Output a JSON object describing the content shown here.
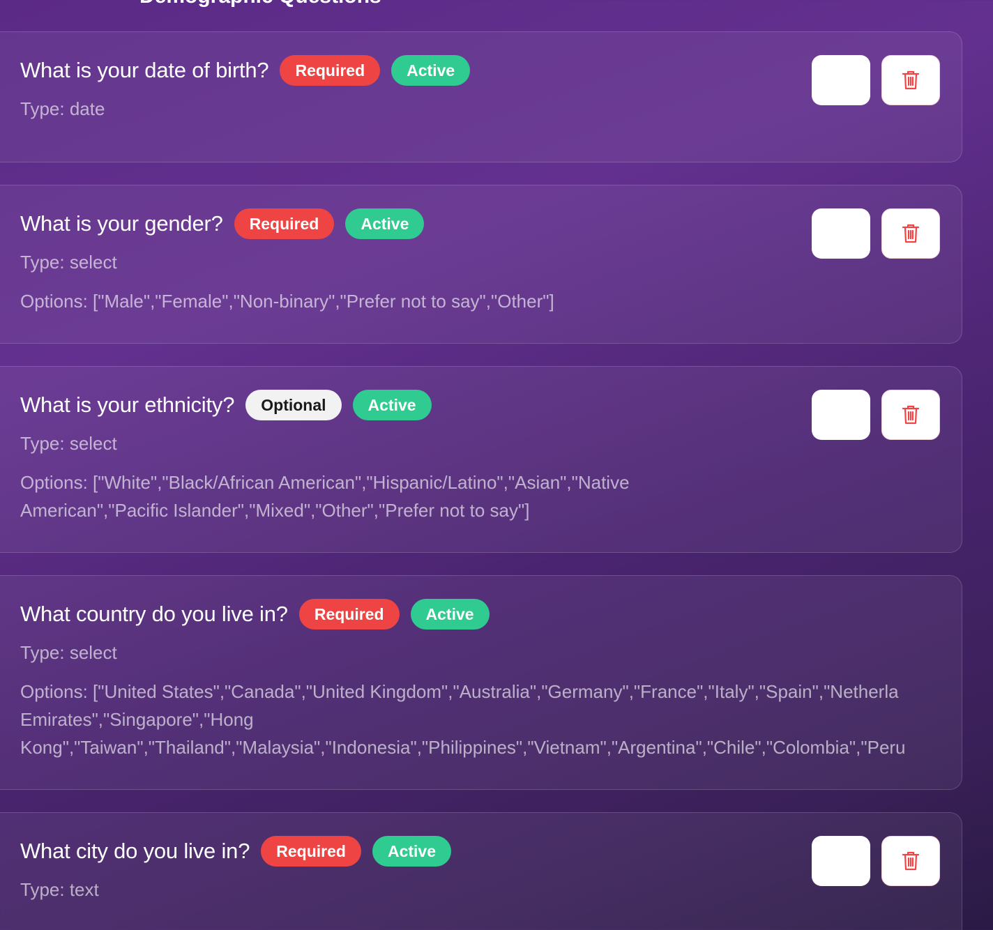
{
  "header": {
    "clipped_title": "Demographic Questions"
  },
  "questions": [
    {
      "title": "What is your date of birth?",
      "requirement": "Required",
      "status": "Active",
      "type": "Type: date",
      "options_lines": []
    },
    {
      "title": "What is your gender?",
      "requirement": "Required",
      "status": "Active",
      "type": "Type: select",
      "options_lines": [
        "Options: [\"Male\",\"Female\",\"Non-binary\",\"Prefer not to say\",\"Other\"]"
      ]
    },
    {
      "title": "What is your ethnicity?",
      "requirement": "Optional",
      "status": "Active",
      "type": "Type: select",
      "options_lines": [
        "Options: [\"White\",\"Black/African American\",\"Hispanic/Latino\",\"Asian\",\"Native",
        "American\",\"Pacific Islander\",\"Mixed\",\"Other\",\"Prefer not to say\"]"
      ]
    },
    {
      "title": "What country do you live in?",
      "requirement": "Required",
      "status": "Active",
      "type": "Type: select",
      "options_lines": [
        "Options: [\"United States\",\"Canada\",\"United Kingdom\",\"Australia\",\"Germany\",\"France\",\"Italy\",\"Spain\",\"Netherla",
        "Emirates\",\"Singapore\",\"Hong",
        "Kong\",\"Taiwan\",\"Thailand\",\"Malaysia\",\"Indonesia\",\"Philippines\",\"Vietnam\",\"Argentina\",\"Chile\",\"Colombia\",\"Peru"
      ]
    },
    {
      "title": "What city do you live in?",
      "requirement": "Required",
      "status": "Active",
      "type": "Type: text",
      "options_lines": []
    }
  ],
  "colors": {
    "required": "#ef4444",
    "optional": "#f2f2f3",
    "active": "#2fcb91",
    "delete_icon": "#ef4444"
  },
  "icons": {
    "delete": "trash-icon"
  }
}
